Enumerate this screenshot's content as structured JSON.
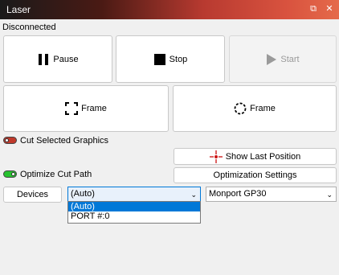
{
  "window": {
    "title": "Laser",
    "float_glyph": "⧉",
    "close_glyph": "✕"
  },
  "status": "Disconnected",
  "controls": {
    "pause": "Pause",
    "stop": "Stop",
    "start": "Start",
    "frame_square": "Frame",
    "frame_circle": "Frame"
  },
  "options": {
    "cut_selected": "Cut Selected Graphics",
    "cut_selected_on": false,
    "optimize_cut_path": "Optimize Cut Path",
    "optimize_cut_path_on": true,
    "show_last_position": "Show Last Position",
    "optimization_settings": "Optimization Settings"
  },
  "device_row": {
    "devices_button": "Devices",
    "port_select_value": "(Auto)",
    "device_select_value": "Monport GP30",
    "arrow_glyph": "⌄"
  },
  "port_dropdown": {
    "options": [
      "(Auto)",
      "PORT #:0"
    ],
    "selected_index": 0
  },
  "colors": {
    "toggle_off": "#c0392b",
    "toggle_on": "#27c22f",
    "selection": "#0078d7",
    "crosshair": "#cc1111"
  }
}
